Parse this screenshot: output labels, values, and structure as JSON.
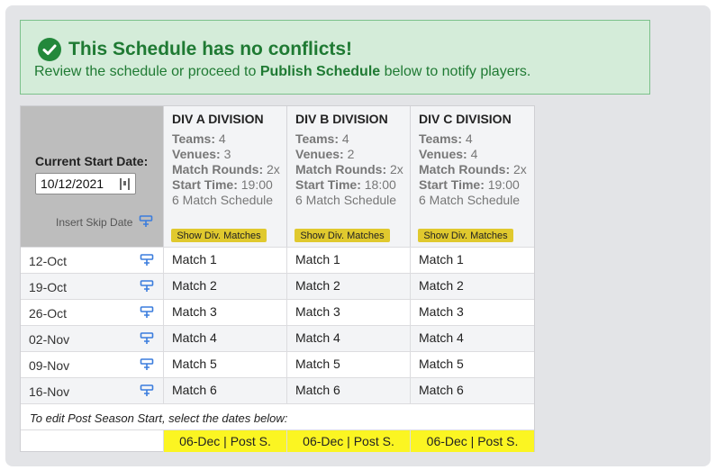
{
  "banner": {
    "title": "This Schedule has no conflicts!",
    "msg_pre": "Review the schedule or proceed to ",
    "msg_bold": "Publish Schedule",
    "msg_post": " below to notify players."
  },
  "start": {
    "label": "Current Start Date:",
    "value": "10/12/2021",
    "skip_label": "Insert Skip Date"
  },
  "info_labels": {
    "teams": "Teams:",
    "venues": "Venues:",
    "rounds": "Match Rounds:",
    "start_time": "Start Time:"
  },
  "divisions": [
    {
      "name": "DIV A DIVISION",
      "teams": "4",
      "venues": "3",
      "rounds": "2x",
      "start_time": "19:00",
      "schedule": "6 Match Schedule",
      "button": "Show Div. Matches"
    },
    {
      "name": "DIV B DIVISION",
      "teams": "4",
      "venues": "2",
      "rounds": "2x",
      "start_time": "18:00",
      "schedule": "6 Match Schedule",
      "button": "Show Div. Matches"
    },
    {
      "name": "DIV C DIVISION",
      "teams": "4",
      "venues": "4",
      "rounds": "2x",
      "start_time": "19:00",
      "schedule": "6 Match Schedule",
      "button": "Show Div. Matches"
    }
  ],
  "rows": [
    {
      "date": "12-Oct",
      "matches": [
        "Match 1",
        "Match 1",
        "Match 1"
      ]
    },
    {
      "date": "19-Oct",
      "matches": [
        "Match 2",
        "Match 2",
        "Match 2"
      ]
    },
    {
      "date": "26-Oct",
      "matches": [
        "Match 3",
        "Match 3",
        "Match 3"
      ]
    },
    {
      "date": "02-Nov",
      "matches": [
        "Match 4",
        "Match 4",
        "Match 4"
      ]
    },
    {
      "date": "09-Nov",
      "matches": [
        "Match 5",
        "Match 5",
        "Match 5"
      ]
    },
    {
      "date": "16-Nov",
      "matches": [
        "Match 6",
        "Match 6",
        "Match 6"
      ]
    }
  ],
  "post_season": {
    "note": "To edit Post Season Start, select the dates below:",
    "cells": [
      "06-Dec | Post S.",
      "06-Dec | Post S.",
      "06-Dec | Post S."
    ]
  },
  "colors": {
    "success_green": "#1f7a33",
    "banner_bg": "#d4ecd9",
    "button_yellow": "#e0c92e",
    "post_yellow": "#fbf522",
    "insert_icon_blue": "#3b7ddd"
  },
  "icons": {
    "banner": "check-circle-icon",
    "insert": "insert-row-icon",
    "date_picker": "calendar-icon"
  }
}
